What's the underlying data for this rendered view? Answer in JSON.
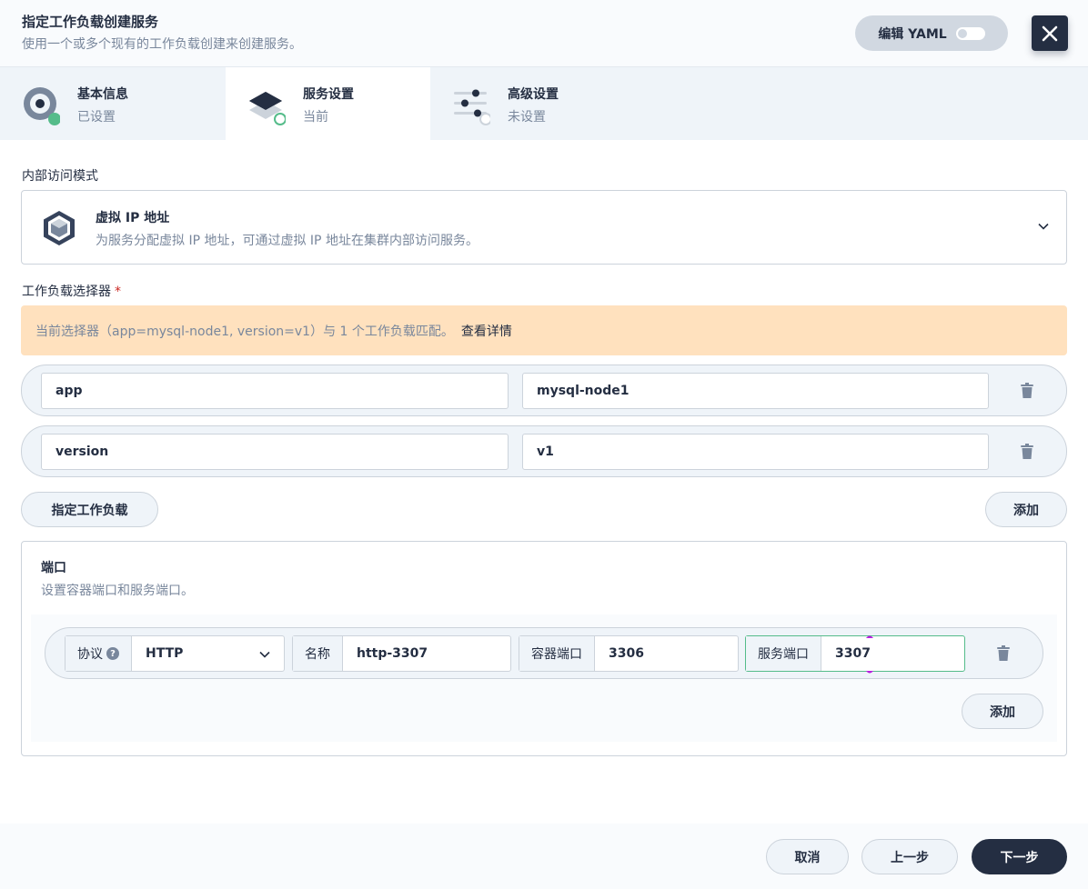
{
  "header": {
    "title": "指定工作负载创建服务",
    "description": "使用一个或多个现有的工作负载创建来创建服务。",
    "yaml_label": "编辑 YAML",
    "yaml_enabled": false,
    "close_icon": "close-icon"
  },
  "steps": [
    {
      "title": "基本信息",
      "status": "已设置",
      "icon": "info-disc-icon"
    },
    {
      "title": "服务设置",
      "status": "当前",
      "icon": "layers-icon"
    },
    {
      "title": "高级设置",
      "status": "未设置",
      "icon": "sliders-icon"
    }
  ],
  "access_mode": {
    "label": "内部访问模式",
    "title": "虚拟 IP 地址",
    "description": "为服务分配虚拟 IP 地址，可通过虚拟 IP 地址在集群内部访问服务。",
    "icon": "cube-icon"
  },
  "selector": {
    "label": "工作负载选择器",
    "required_mark": "*",
    "notice": "当前选择器（app=mysql-node1, version=v1）与 1 个工作负载匹配。",
    "notice_link": "查看详情",
    "rows": [
      {
        "key": "app",
        "value": "mysql-node1"
      },
      {
        "key": "version",
        "value": "v1"
      }
    ],
    "specify_button": "指定工作负载",
    "add_button": "添加"
  },
  "ports": {
    "title": "端口",
    "description": "设置容器端口和服务端口。",
    "rows": [
      {
        "protocol_label": "协议",
        "protocol_help": "?",
        "protocol": "HTTP",
        "name_label": "名称",
        "name": "http-3307",
        "container_port_label": "容器端口",
        "container_port": "3306",
        "service_port_label": "服务端口",
        "service_port": "3307"
      }
    ],
    "add_button": "添加"
  },
  "footer": {
    "cancel": "取消",
    "prev": "上一步",
    "next": "下一步"
  }
}
